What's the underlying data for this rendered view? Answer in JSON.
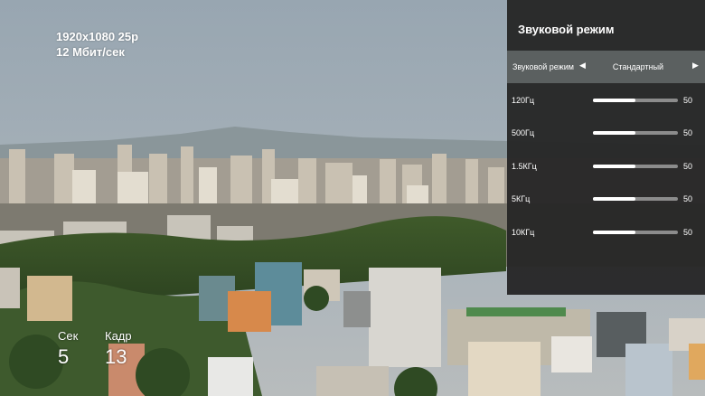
{
  "stream": {
    "resolution": "1920x1080 25p",
    "bitrate": "12 Мбит/сек"
  },
  "counters": {
    "seconds_label": "Сек",
    "seconds_value": "5",
    "frame_label": "Кадр",
    "frame_value": "13"
  },
  "sound_panel": {
    "title": "Звуковой режим",
    "mode_label": "Звуковой режим",
    "mode_value": "Стандартный",
    "bands": [
      {
        "label": "120Гц",
        "value": 50
      },
      {
        "label": "500Гц",
        "value": 50
      },
      {
        "label": "1.5КГц",
        "value": 50
      },
      {
        "label": "5КГц",
        "value": 50
      },
      {
        "label": "10КГц",
        "value": 50
      }
    ],
    "band_max": 100
  },
  "icons": {
    "left": "arrow-left-icon",
    "right": "arrow-right-icon"
  }
}
